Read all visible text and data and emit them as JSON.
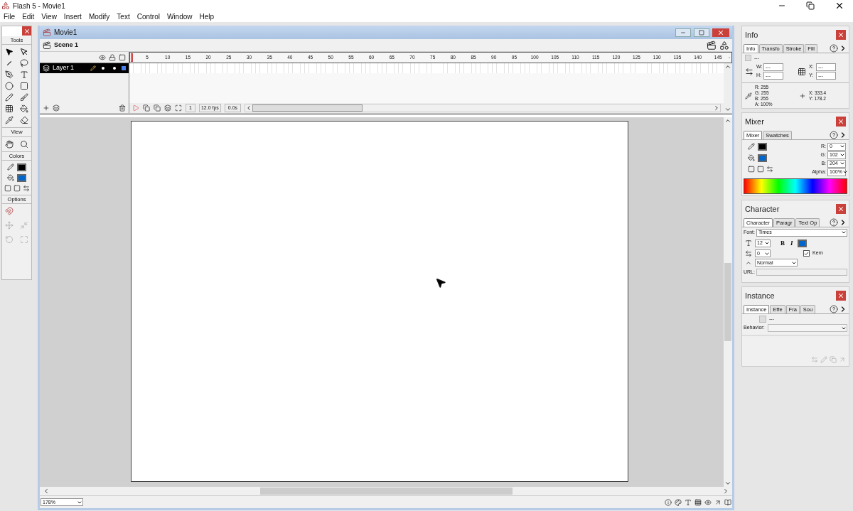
{
  "window": {
    "title": "Flash 5 - Movie1"
  },
  "menu": [
    "File",
    "Edit",
    "View",
    "Insert",
    "Modify",
    "Text",
    "Control",
    "Window",
    "Help"
  ],
  "tools_panel": {
    "title": "Tools",
    "view_label": "View",
    "colors_label": "Colors",
    "options_label": "Options"
  },
  "movie": {
    "title": "Movie1",
    "scene": "Scene 1",
    "layers": [
      {
        "name": "Layer 1",
        "selected": true
      }
    ],
    "ruler": [
      "5",
      "10",
      "15",
      "20",
      "25",
      "30",
      "35",
      "40",
      "45",
      "50",
      "55",
      "60",
      "65",
      "70",
      "75",
      "80",
      "85",
      "90",
      "95",
      "100",
      "105",
      "110",
      "115",
      "120",
      "125",
      "130",
      "135",
      "140",
      "145"
    ],
    "current_frame": "1",
    "frame_rate": "12.0 fps",
    "elapsed": "0.0s",
    "zoom": "178%"
  },
  "info": {
    "title": "Info",
    "tabs": [
      {
        "label": "Info",
        "selected": true
      },
      {
        "label": "Transfo",
        "selected": false
      },
      {
        "label": "Stroke",
        "selected": false
      },
      {
        "label": "Fill",
        "selected": false
      }
    ],
    "symbol": "---",
    "size_fields": [
      {
        "label": "W:",
        "value": "---"
      },
      {
        "label": "H:",
        "value": "---"
      }
    ],
    "position_fields": [
      {
        "label": "X:",
        "value": "---"
      },
      {
        "label": "Y:",
        "value": "---"
      }
    ],
    "color_readout": [
      "R: 255",
      "G: 255",
      "B: 255",
      "A: 100%"
    ],
    "cursor_readout": [
      "X: 333.4",
      "Y: 178.2"
    ]
  },
  "mixer": {
    "title": "Mixer",
    "tabs": [
      {
        "label": "Mixer",
        "selected": true
      },
      {
        "label": "Swatches",
        "selected": false
      }
    ],
    "channels": [
      {
        "label": "R:",
        "value": "0"
      },
      {
        "label": "G:",
        "value": "102"
      },
      {
        "label": "B:",
        "value": "204"
      },
      {
        "label": "Alpha:",
        "value": "100%"
      }
    ]
  },
  "character": {
    "title": "Character",
    "tabs": [
      {
        "label": "Character",
        "selected": true
      },
      {
        "label": "Paragr",
        "selected": false
      },
      {
        "label": "Text Op",
        "selected": false
      }
    ],
    "font_label": "Font:",
    "font": "Times",
    "size": "12",
    "bold": "B",
    "italic": "I",
    "tracking": "0",
    "kern": {
      "label": "Kern",
      "checked": true
    },
    "baseline": "Normal",
    "url_label": "URL:"
  },
  "instance": {
    "title": "Instance",
    "tabs": [
      {
        "label": "Instance",
        "selected": true
      },
      {
        "label": "Effe",
        "selected": false
      },
      {
        "label": "Fra",
        "selected": false
      },
      {
        "label": "Sou",
        "selected": false
      }
    ],
    "symbol": "---",
    "behavior_label": "Behavior:"
  }
}
